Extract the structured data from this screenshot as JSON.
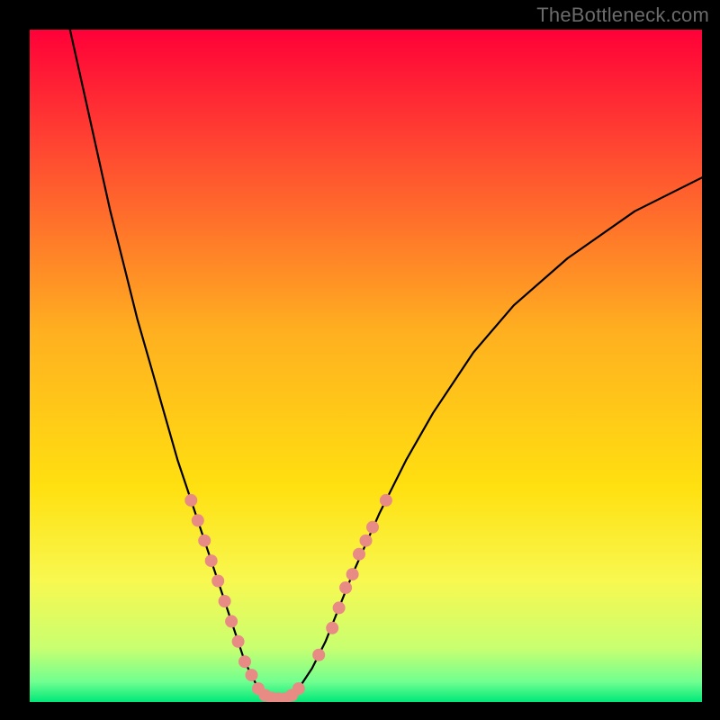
{
  "watermark": "TheBottleneck.com",
  "colors": {
    "gradient": [
      "#ff0038",
      "#ff5030",
      "#ffb020",
      "#ffe010",
      "#f8f850",
      "#c8ff70",
      "#70ff90",
      "#00e878"
    ],
    "curve": "#000000",
    "marker": "#e98b85",
    "background_frame": "#000000"
  },
  "chart_data": {
    "type": "line",
    "title": "",
    "xlabel": "",
    "ylabel": "",
    "xlim": [
      0,
      100
    ],
    "ylim": [
      0,
      100
    ],
    "grid": false,
    "legend": false,
    "series": [
      {
        "name": "bottleneck_curve",
        "x": [
          6,
          8,
          10,
          12,
          14,
          16,
          18,
          20,
          22,
          24,
          26,
          28,
          30,
          31,
          32,
          33,
          34,
          35,
          36,
          38,
          40,
          42,
          44,
          46,
          48,
          52,
          56,
          60,
          66,
          72,
          80,
          90,
          100
        ],
        "y": [
          100,
          91,
          82,
          73,
          65,
          57,
          50,
          43,
          36,
          30,
          24,
          18,
          12,
          9,
          6,
          4,
          2,
          1,
          0.5,
          0.5,
          2,
          5,
          9,
          14,
          19,
          28,
          36,
          43,
          52,
          59,
          66,
          73,
          78
        ]
      }
    ],
    "markers": {
      "series": "bottleneck_curve",
      "points": [
        {
          "x": 24,
          "y": 30
        },
        {
          "x": 25,
          "y": 27
        },
        {
          "x": 26,
          "y": 24
        },
        {
          "x": 27,
          "y": 21
        },
        {
          "x": 28,
          "y": 18
        },
        {
          "x": 29,
          "y": 15
        },
        {
          "x": 30,
          "y": 12
        },
        {
          "x": 31,
          "y": 9
        },
        {
          "x": 32,
          "y": 6
        },
        {
          "x": 33,
          "y": 4
        },
        {
          "x": 34,
          "y": 2
        },
        {
          "x": 35,
          "y": 1
        },
        {
          "x": 36,
          "y": 0.6
        },
        {
          "x": 37,
          "y": 0.5
        },
        {
          "x": 38,
          "y": 0.5
        },
        {
          "x": 39,
          "y": 1
        },
        {
          "x": 40,
          "y": 2
        },
        {
          "x": 43,
          "y": 7
        },
        {
          "x": 45,
          "y": 11
        },
        {
          "x": 46,
          "y": 14
        },
        {
          "x": 47,
          "y": 17
        },
        {
          "x": 48,
          "y": 19
        },
        {
          "x": 49,
          "y": 22
        },
        {
          "x": 50,
          "y": 24
        },
        {
          "x": 51,
          "y": 26
        },
        {
          "x": 53,
          "y": 30
        }
      ],
      "radius": 7,
      "color": "#e98b85"
    }
  }
}
